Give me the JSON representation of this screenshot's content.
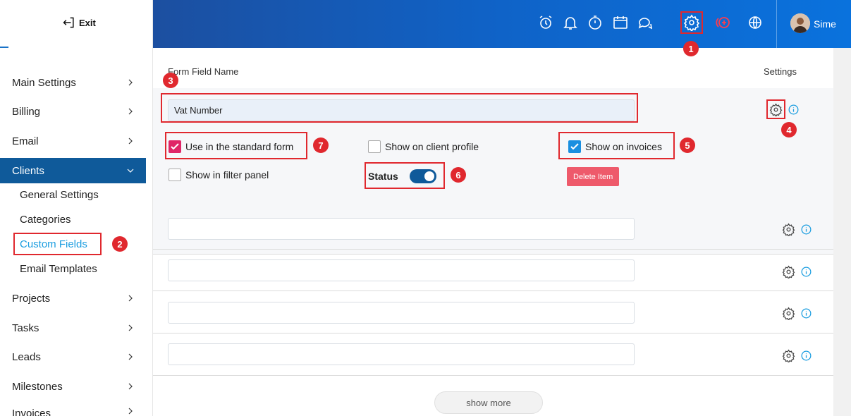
{
  "sidebar": {
    "exit_label": "Exit",
    "items": [
      {
        "label": "Main Settings"
      },
      {
        "label": "Billing"
      },
      {
        "label": "Email"
      },
      {
        "label": "Clients"
      },
      {
        "label": "Projects"
      },
      {
        "label": "Tasks"
      },
      {
        "label": "Leads"
      },
      {
        "label": "Milestones"
      },
      {
        "label": "Invoices"
      }
    ],
    "subitems": [
      {
        "label": "General Settings"
      },
      {
        "label": "Categories"
      },
      {
        "label": "Custom Fields"
      },
      {
        "label": "Email Templates"
      }
    ]
  },
  "topbar": {
    "icons": [
      "alarm-icon",
      "bell-icon",
      "timer-icon",
      "calendar-icon",
      "chat-icon",
      "gear-icon",
      "add-icon",
      "globe-icon"
    ],
    "user_name": "Sime"
  },
  "main": {
    "col_field_name": "Form Field Name",
    "col_settings": "Settings",
    "expanded_field_value": "Vat Number",
    "checkboxes": {
      "standard_form": "Use in the standard form",
      "client_profile": "Show on client profile",
      "invoices": "Show on invoices",
      "filter_panel": "Show in filter panel"
    },
    "status_label": "Status",
    "delete_label": "Delete Item",
    "show_more_label": "show more"
  },
  "annotations": [
    "1",
    "2",
    "3",
    "4",
    "5",
    "6",
    "7"
  ],
  "colors": {
    "primary": "#0f5a9a",
    "accent": "#1a9de0",
    "annotation": "#e0282e",
    "checkbox_pink": "#e02667",
    "delete": "#ee5a6b"
  }
}
